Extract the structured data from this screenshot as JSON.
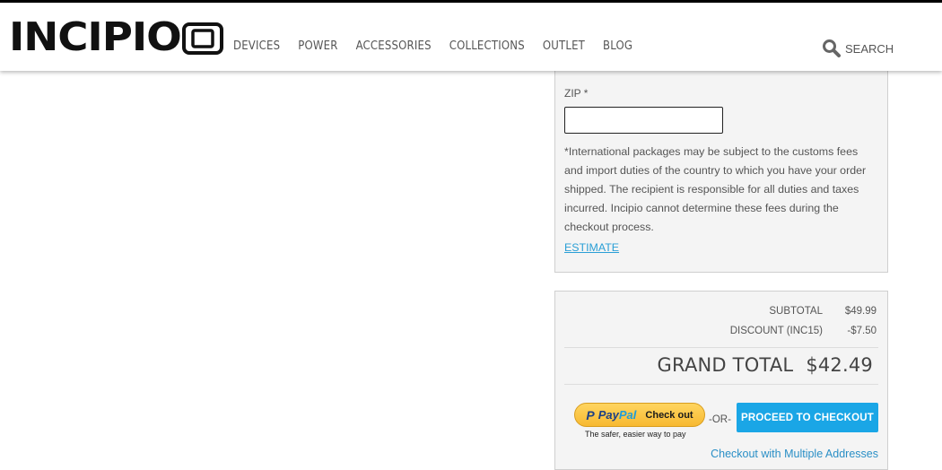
{
  "header": {
    "brand": "INCIPIO",
    "nav": [
      "DEVICES",
      "POWER",
      "ACCESSORIES",
      "COLLECTIONS",
      "OUTLET",
      "BLOG"
    ],
    "search_label": "SEARCH",
    "search_icon": "search-icon"
  },
  "shipping": {
    "zip_label": "ZIP *",
    "zip_value": "",
    "note": "*International packages may be subject to the customs fees and import duties of the country to which you have your order shipped. The recipient is responsible for all duties and taxes incurred. Incipio cannot determine these fees during the checkout process.",
    "estimate_link": "ESTIMATE"
  },
  "totals": {
    "subtotal_label": "SUBTOTAL",
    "subtotal_value": "$49.99",
    "discount_label": "DISCOUNT (INC15)",
    "discount_value": "-$7.50",
    "grand_label": "GRAND TOTAL",
    "grand_value": "$42.49"
  },
  "checkout": {
    "paypal_p": "P",
    "paypal_pay": "Pay",
    "paypal_pal": "Pal",
    "paypal_checkout": "Check out",
    "paypal_tagline": "The safer, easier way to pay",
    "or_label": "-OR-",
    "proceed_label": "PROCEED TO CHECKOUT",
    "multi_address_link": "Checkout with Multiple Addresses"
  },
  "colors": {
    "accent": "#1aa6e6",
    "link": "#2a9fd6",
    "panel_bg": "#f4f4f4"
  }
}
